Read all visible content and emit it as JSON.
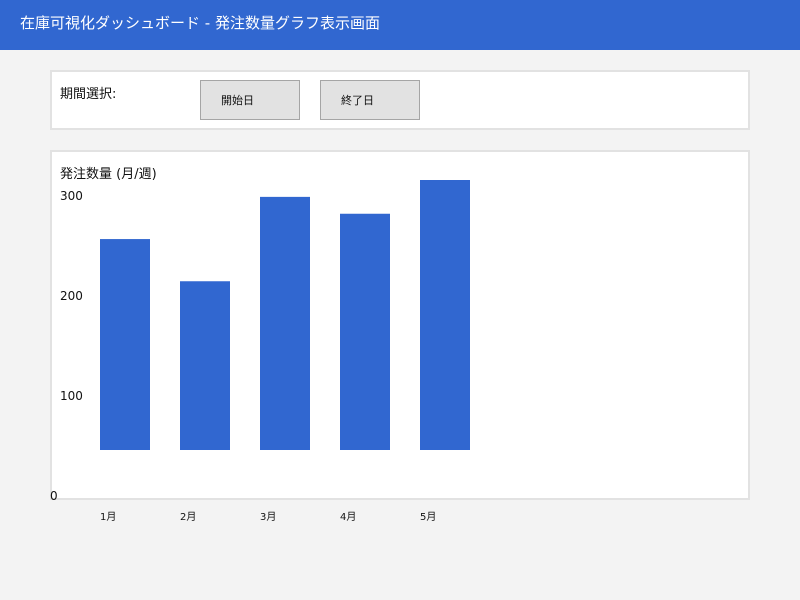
{
  "header": {
    "title": "在庫可視化ダッシュボード - 発注数量グラフ表示画面"
  },
  "period": {
    "label": "期間選択:",
    "start_button": "開始日",
    "end_button": "終了日"
  },
  "colors": {
    "header_bg": "#3167d0",
    "bar": "#3167d0",
    "page_bg": "#f3f3f3",
    "panel_border": "#e2e2e2",
    "button_bg": "#e2e2e2"
  },
  "chart_data": {
    "type": "bar",
    "title": "発注数量 (月/週)",
    "xlabel": "",
    "ylabel": "",
    "categories": [
      "1月",
      "2月",
      "3月",
      "4月",
      "5月"
    ],
    "values": [
      250,
      200,
      300,
      280,
      320
    ],
    "y_ticks": [
      0,
      100,
      200,
      300
    ],
    "ylim": [
      0,
      330
    ],
    "grid": false,
    "legend": "none"
  }
}
